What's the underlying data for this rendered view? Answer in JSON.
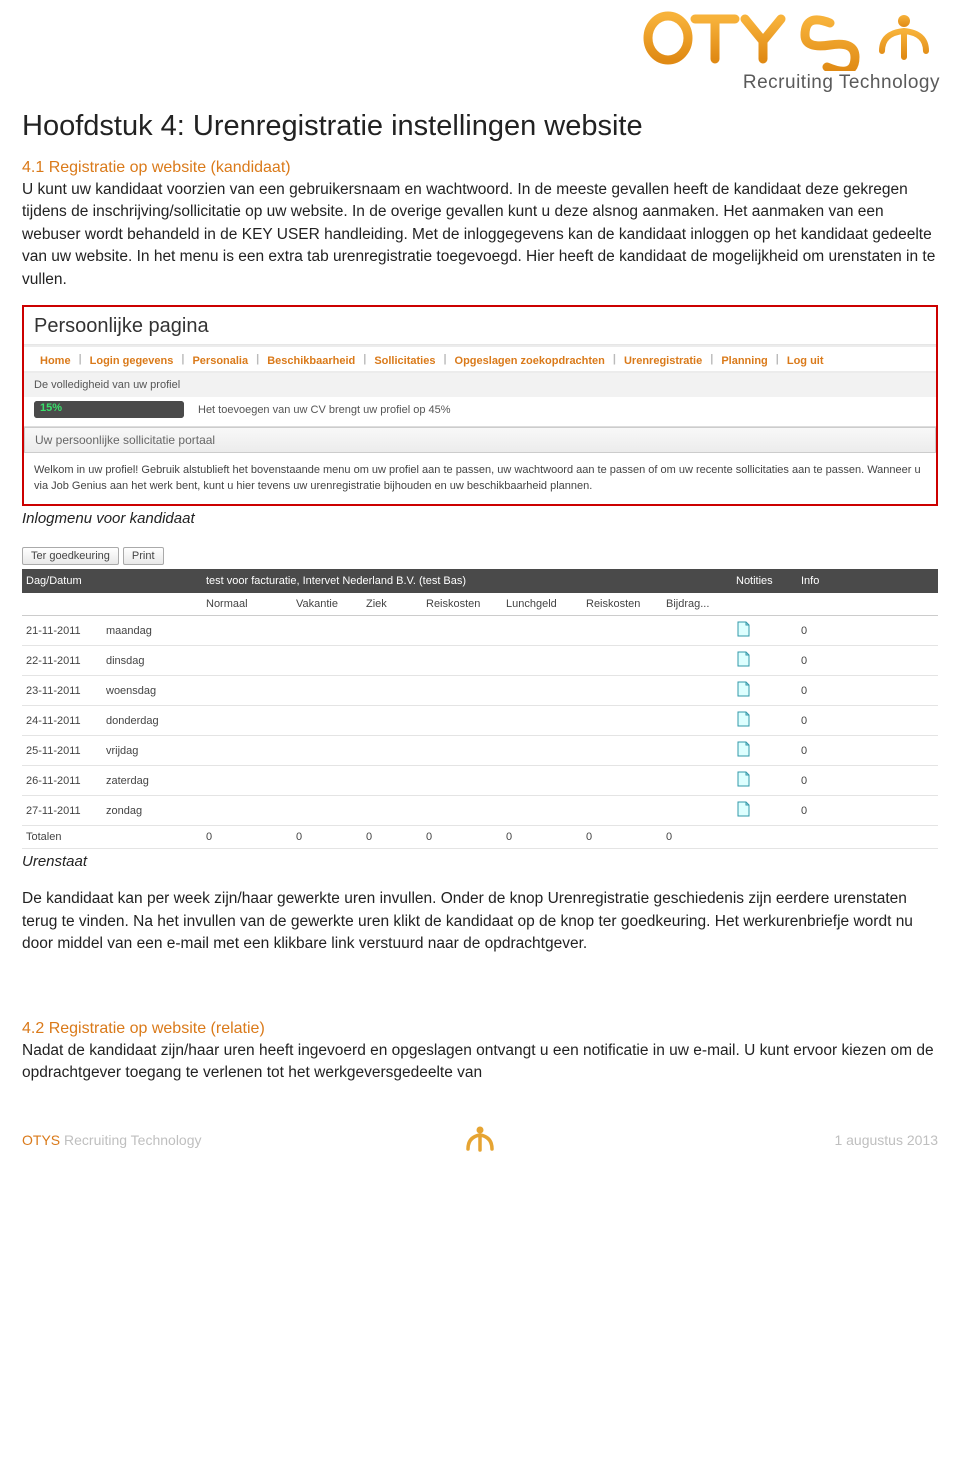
{
  "logo": {
    "brand": "OTYS",
    "sub": "Recruiting Technology"
  },
  "h1": "Hoofdstuk 4: Urenregistratie instellingen website",
  "sec41_title": "4.1 Registratie op website (kandidaat)",
  "para1": "U kunt uw kandidaat voorzien van een gebruikersnaam en wachtwoord. In de meeste gevallen heeft de kandidaat deze gekregen tijdens de inschrijving/sollicitatie op uw website. In de overige gevallen kunt u deze alsnog aanmaken. Het aanmaken van een webuser wordt behandeld in de KEY USER handleiding. Met de inloggegevens kan de kandidaat inloggen op het kandidaat gedeelte van uw website. In het menu is een extra tab urenregistratie toegevoegd. Hier heeft de kandidaat de mogelijkheid om urenstaten in te vullen.",
  "caption1": "Inlogmenu voor kandidaat",
  "caption2": "Urenstaat",
  "shot1": {
    "title": "Persoonlijke pagina",
    "tabs": [
      "Home",
      "Login gegevens",
      "Personalia",
      "Beschikbaarheid",
      "Sollicitaties",
      "Opgeslagen zoekopdrachten",
      "Urenregistratie",
      "Planning",
      "Log uit"
    ],
    "profile_label": "De volledigheid van uw profiel",
    "progress_pct": "15%",
    "progress_text": "Het toevoegen van uw CV brengt uw profiel op 45%",
    "portal_head": "Uw persoonlijke sollicitatie portaal",
    "welcome": "Welkom in uw profiel! Gebruik alstublieft het bovenstaande menu om uw profiel aan te passen, uw wachtwoord aan te passen of om uw recente sollicitaties aan te passen. Wanneer u via Job Genius aan het werk bent, kunt u hier tevens uw urenregistratie bijhouden en uw beschikbaarheid plannen."
  },
  "shot2": {
    "btn_ter": "Ter goedkeuring",
    "btn_print": "Print",
    "col_dagdatum": "Dag/Datum",
    "col_project": "test voor facturatie, Intervet Nederland B.V. (test Bas)",
    "col_notities": "Notities",
    "col_info": "Info",
    "subcols": [
      "Normaal",
      "Vakantie",
      "Ziek",
      "Reiskosten",
      "Lunchgeld",
      "Reiskosten",
      "Bijdrag..."
    ],
    "rows": [
      {
        "date": "21-11-2011",
        "day": "maandag",
        "info": "0"
      },
      {
        "date": "22-11-2011",
        "day": "dinsdag",
        "info": "0"
      },
      {
        "date": "23-11-2011",
        "day": "woensdag",
        "info": "0"
      },
      {
        "date": "24-11-2011",
        "day": "donderdag",
        "info": "0"
      },
      {
        "date": "25-11-2011",
        "day": "vrijdag",
        "info": "0"
      },
      {
        "date": "26-11-2011",
        "day": "zaterdag",
        "info": "0"
      },
      {
        "date": "27-11-2011",
        "day": "zondag",
        "info": "0"
      }
    ],
    "totals_label": "Totalen",
    "totals": [
      "0",
      "0",
      "0",
      "0",
      "0",
      "0",
      "0"
    ]
  },
  "para2": "De kandidaat kan per week zijn/haar gewerkte uren invullen. Onder de knop Urenregistratie geschiedenis zijn eerdere urenstaten terug te vinden. Na het invullen van de gewerkte uren klikt de kandidaat op de knop ter goedkeuring. Het werkurenbriefje wordt nu door middel van een e-mail met een klikbare link verstuurd naar de opdrachtgever.",
  "sec42_title": "4.2 Registratie op website (relatie)",
  "para3": "Nadat de kandidaat zijn/haar uren heeft ingevoerd en opgeslagen ontvangt u een notificatie in uw e-mail. U kunt ervoor kiezen om de opdrachtgever toegang te verlenen tot het werkgeversgedeelte van",
  "footer": {
    "brand": "OTYS",
    "rest": " Recruiting Technology",
    "date": "1 augustus 2013"
  }
}
